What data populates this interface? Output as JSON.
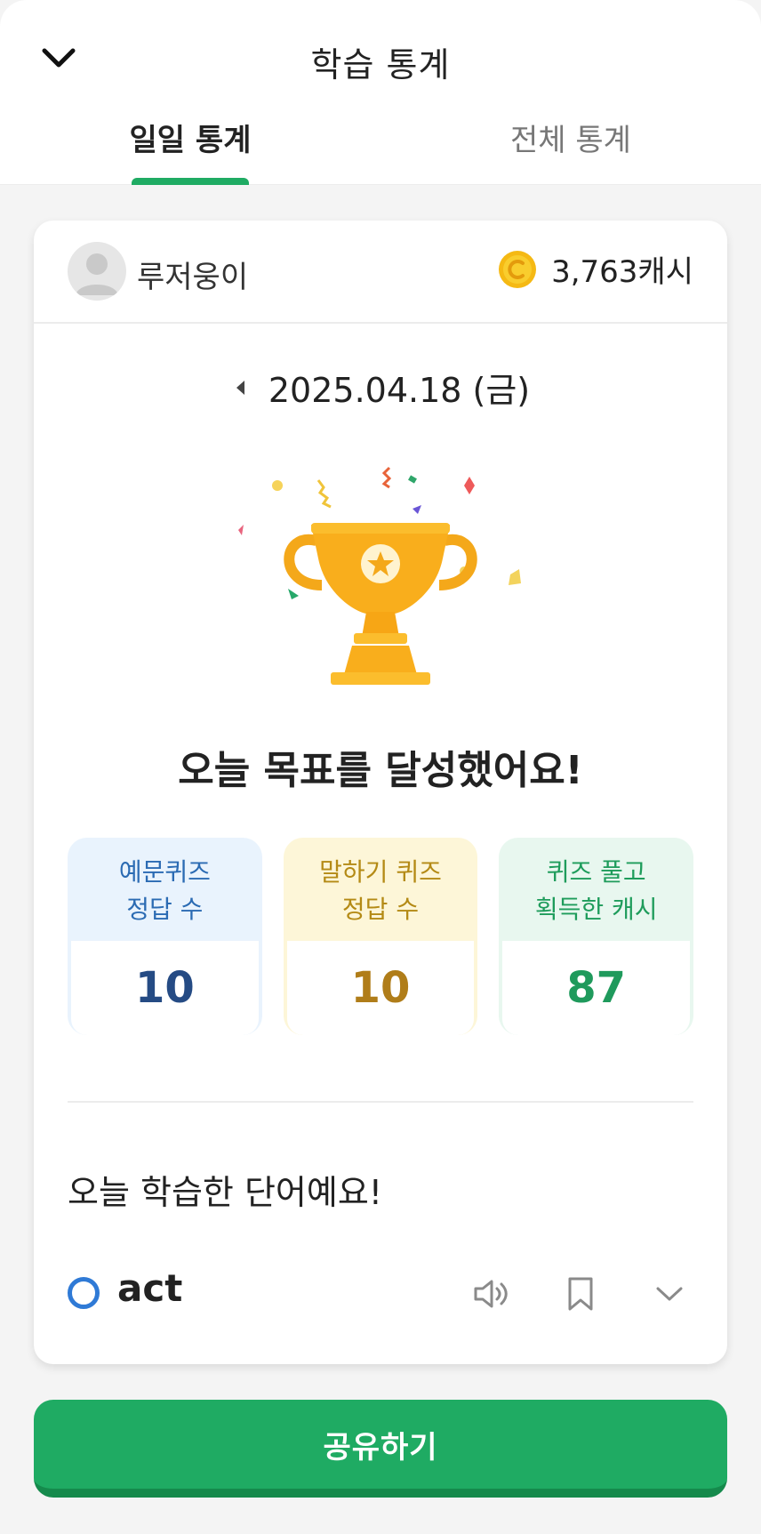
{
  "header": {
    "title": "학습 통계",
    "back_icon": "chevron-down-icon"
  },
  "tabs": [
    {
      "label": "일일 통계",
      "active": true
    },
    {
      "label": "전체 통계",
      "active": false
    }
  ],
  "profile": {
    "username": "루저웅이",
    "cash": "3,763캐시",
    "coin_color": "#f7c31b"
  },
  "date": {
    "text": "2025.04.18 (금)"
  },
  "goal": {
    "message": "오늘 목표를 달성했어요!"
  },
  "stats": [
    {
      "label_line1": "예문퀴즈",
      "label_line2": "정답 수",
      "value": "10",
      "theme": "blue"
    },
    {
      "label_line1": "말하기 퀴즈",
      "label_line2": "정답 수",
      "value": "10",
      "theme": "yellow"
    },
    {
      "label_line1": "퀴즈 풀고",
      "label_line2": "획득한 캐시",
      "value": "87",
      "theme": "green"
    }
  ],
  "words": {
    "heading": "오늘 학습한 단어예요!",
    "items": [
      {
        "word": "act",
        "status_color": "#2f7ad6"
      }
    ]
  },
  "share": {
    "label": "공유하기"
  },
  "colors": {
    "accent": "#1fab63",
    "accent_dark": "#158a4c"
  }
}
